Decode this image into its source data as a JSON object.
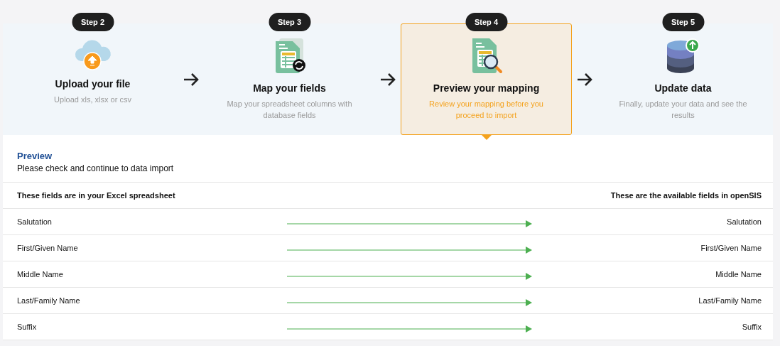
{
  "steps": [
    {
      "badge": "Step 2",
      "title": "Upload your file",
      "description": "Upload xls, xlsx or csv",
      "selected": false
    },
    {
      "badge": "Step 3",
      "title": "Map your fields",
      "description": "Map your spreadsheet columns with database fields",
      "selected": false
    },
    {
      "badge": "Step 4",
      "title": "Preview your mapping",
      "description": "Review your mapping before you proceed to import",
      "selected": true
    },
    {
      "badge": "Step 5",
      "title": "Update data",
      "description": "Finally, update your data and see the results",
      "selected": false
    }
  ],
  "preview": {
    "title": "Preview",
    "subtitle": "Please check and continue to data import"
  },
  "mapping": {
    "columns": [
      "These fields are in your Excel spreadsheet",
      "These are the available fields in openSIS"
    ],
    "rows": [
      {
        "source": "Salutation",
        "target": "Salutation"
      },
      {
        "source": "First/Given Name",
        "target": "First/Given Name"
      },
      {
        "source": "Middle Name",
        "target": "Middle Name"
      },
      {
        "source": "Last/Family Name",
        "target": "Last/Family Name"
      },
      {
        "source": "Suffix",
        "target": "Suffix"
      }
    ]
  }
}
